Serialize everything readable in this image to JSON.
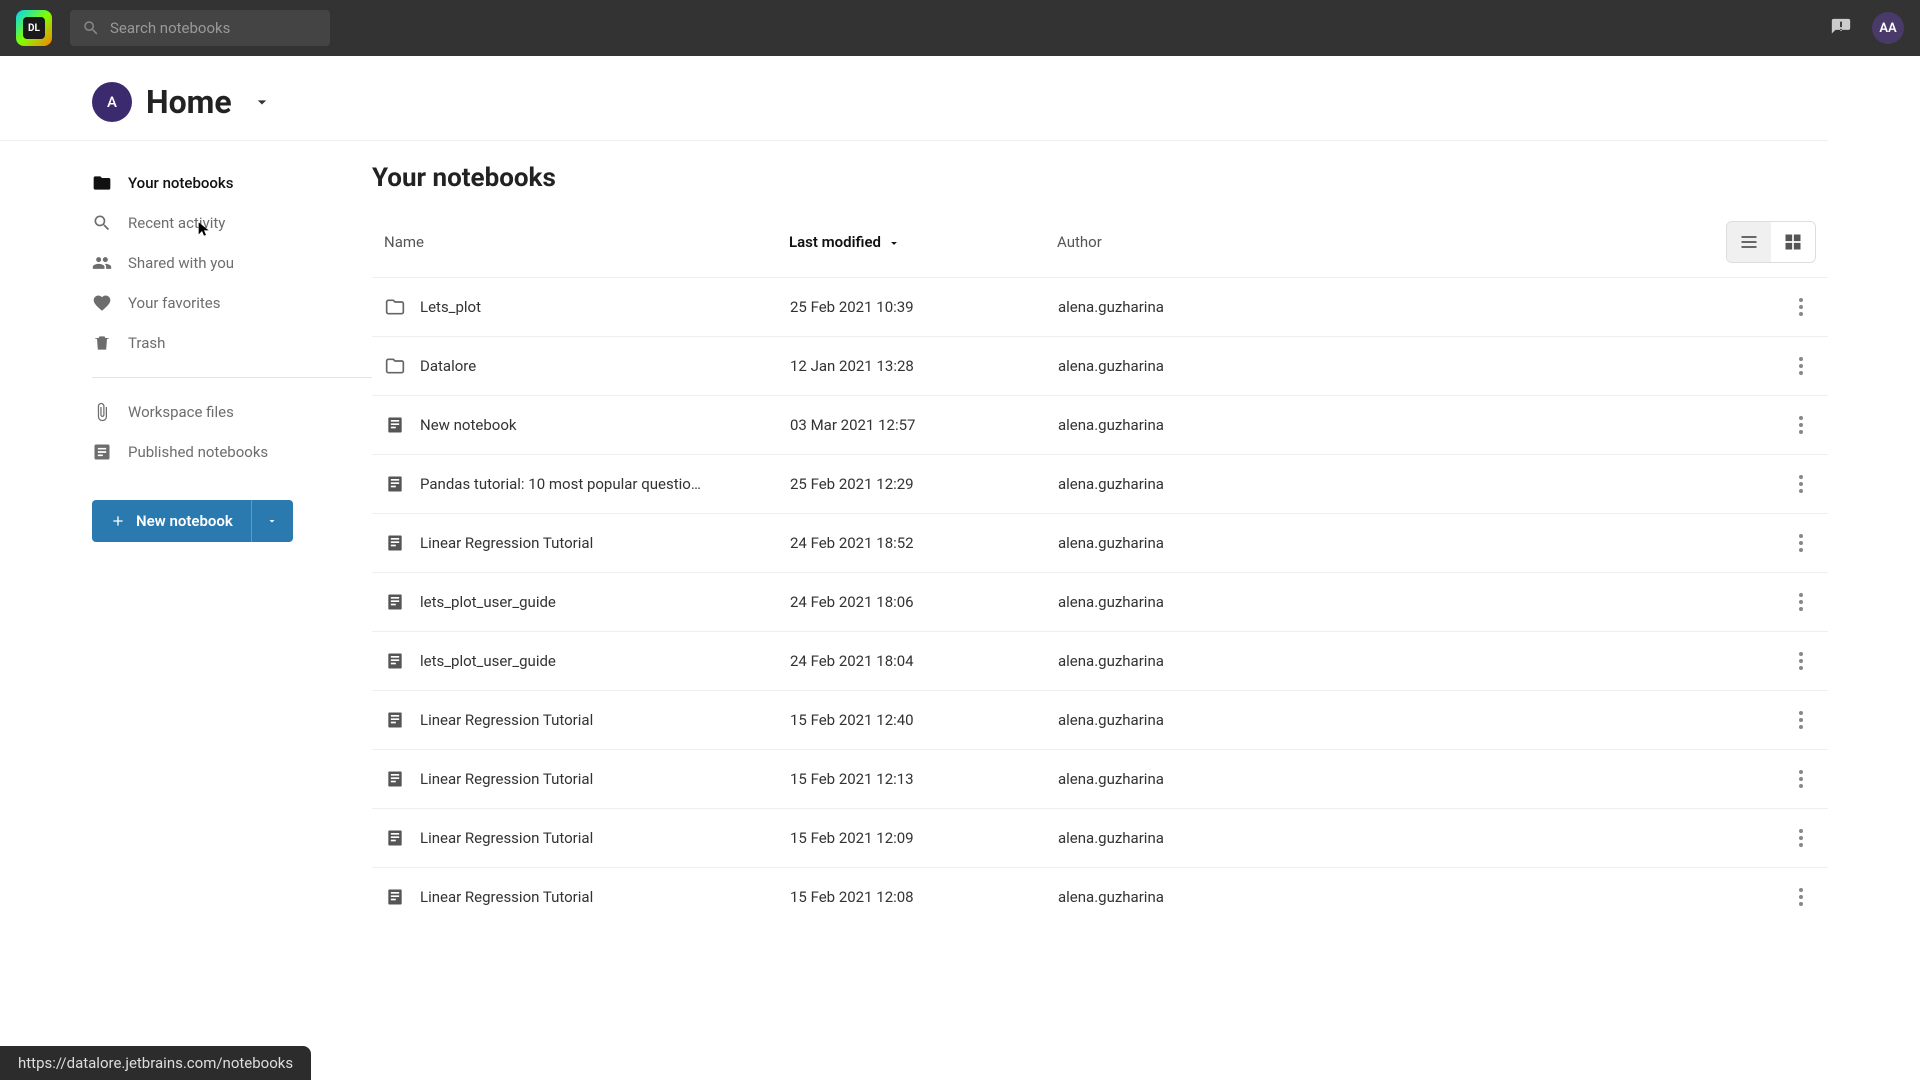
{
  "topbar": {
    "search_placeholder": "Search notebooks",
    "user_initials": "AA",
    "logo_text": "DL"
  },
  "header": {
    "workspace_initial": "A",
    "title": "Home"
  },
  "sidebar": {
    "items": [
      {
        "label": "Your notebooks"
      },
      {
        "label": "Recent activity"
      },
      {
        "label": "Shared with you"
      },
      {
        "label": "Your favorites"
      },
      {
        "label": "Trash"
      }
    ],
    "secondary": [
      {
        "label": "Workspace files"
      },
      {
        "label": "Published notebooks"
      }
    ],
    "new_button": "New notebook"
  },
  "main": {
    "title": "Your notebooks",
    "cols": {
      "name": "Name",
      "modified": "Last modified",
      "author": "Author"
    },
    "rows": [
      {
        "type": "folder",
        "name": "Lets_plot",
        "mod": "25 Feb 2021 10:39",
        "auth": "alena.guzharina"
      },
      {
        "type": "folder",
        "name": "Datalore",
        "mod": "12 Jan 2021 13:28",
        "auth": "alena.guzharina"
      },
      {
        "type": "notebook",
        "name": "New notebook",
        "mod": "03 Mar 2021 12:57",
        "auth": "alena.guzharina"
      },
      {
        "type": "notebook",
        "name": "Pandas tutorial: 10 most popular questio…",
        "mod": "25 Feb 2021 12:29",
        "auth": "alena.guzharina"
      },
      {
        "type": "notebook",
        "name": "Linear Regression Tutorial",
        "mod": "24 Feb 2021 18:52",
        "auth": "alena.guzharina"
      },
      {
        "type": "notebook",
        "name": "lets_plot_user_guide",
        "mod": "24 Feb 2021 18:06",
        "auth": "alena.guzharina"
      },
      {
        "type": "notebook",
        "name": "lets_plot_user_guide",
        "mod": "24 Feb 2021 18:04",
        "auth": "alena.guzharina"
      },
      {
        "type": "notebook",
        "name": "Linear Regression Tutorial",
        "mod": "15 Feb 2021 12:40",
        "auth": "alena.guzharina"
      },
      {
        "type": "notebook",
        "name": "Linear Regression Tutorial",
        "mod": "15 Feb 2021 12:13",
        "auth": "alena.guzharina"
      },
      {
        "type": "notebook",
        "name": "Linear Regression Tutorial",
        "mod": "15 Feb 2021 12:09",
        "auth": "alena.guzharina"
      },
      {
        "type": "notebook",
        "name": "Linear Regression Tutorial",
        "mod": "15 Feb 2021 12:08",
        "auth": "alena.guzharina"
      }
    ]
  },
  "status_url": "https://datalore.jetbrains.com/notebooks"
}
